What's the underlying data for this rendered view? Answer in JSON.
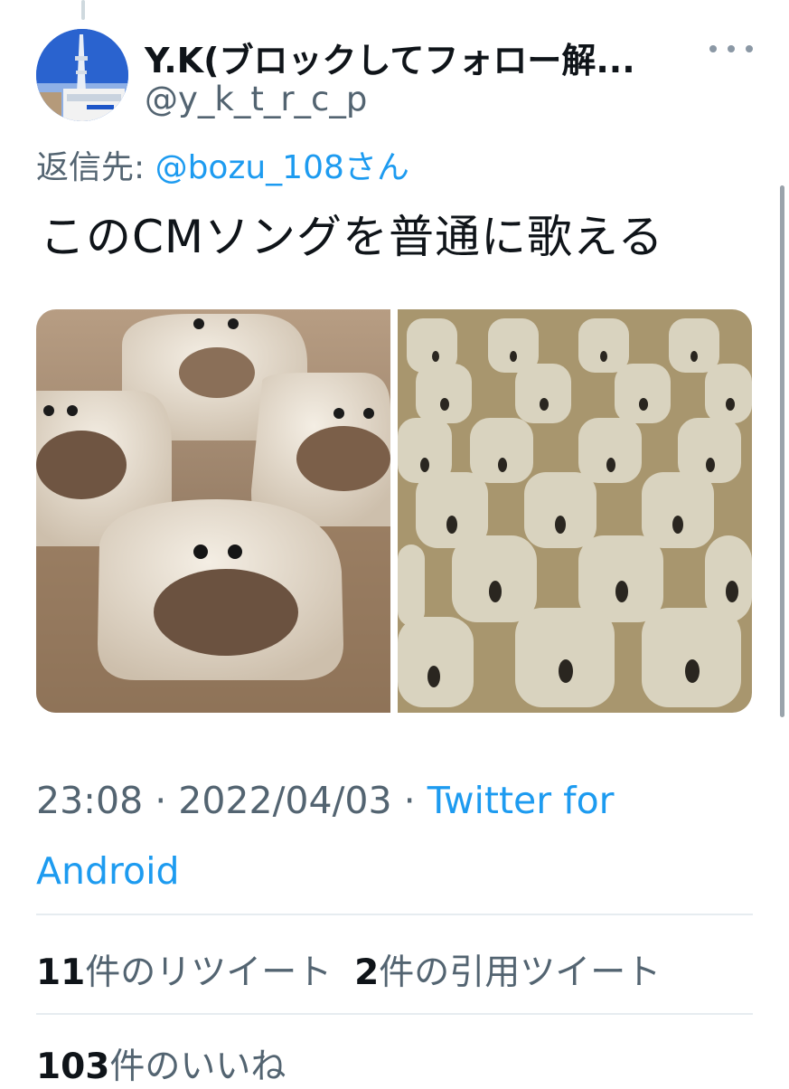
{
  "tweet": {
    "display_name": "Y.K(ブロックしてフォロー解...",
    "handle": "@y_k_t_r_c_p",
    "reply_prefix": "返信先: ",
    "reply_mention": "@bozu_108さん",
    "text": "このCMソングを普通に歌える",
    "images": [
      "blob-creatures-closeup",
      "blob-creatures-crowd"
    ],
    "time": "23:08",
    "date": "2022/04/03",
    "source": "Twitter for Android",
    "retweet_count": "11",
    "retweet_label": "件のリツイート",
    "quote_count": "2",
    "quote_label": "件の引用ツイート",
    "like_count": "103",
    "like_label": "件のいいね"
  },
  "icons": {
    "more": "more-icon"
  },
  "colors": {
    "link": "#1d9bf0",
    "secondary_text": "#536471",
    "primary_text": "#0f1419"
  }
}
